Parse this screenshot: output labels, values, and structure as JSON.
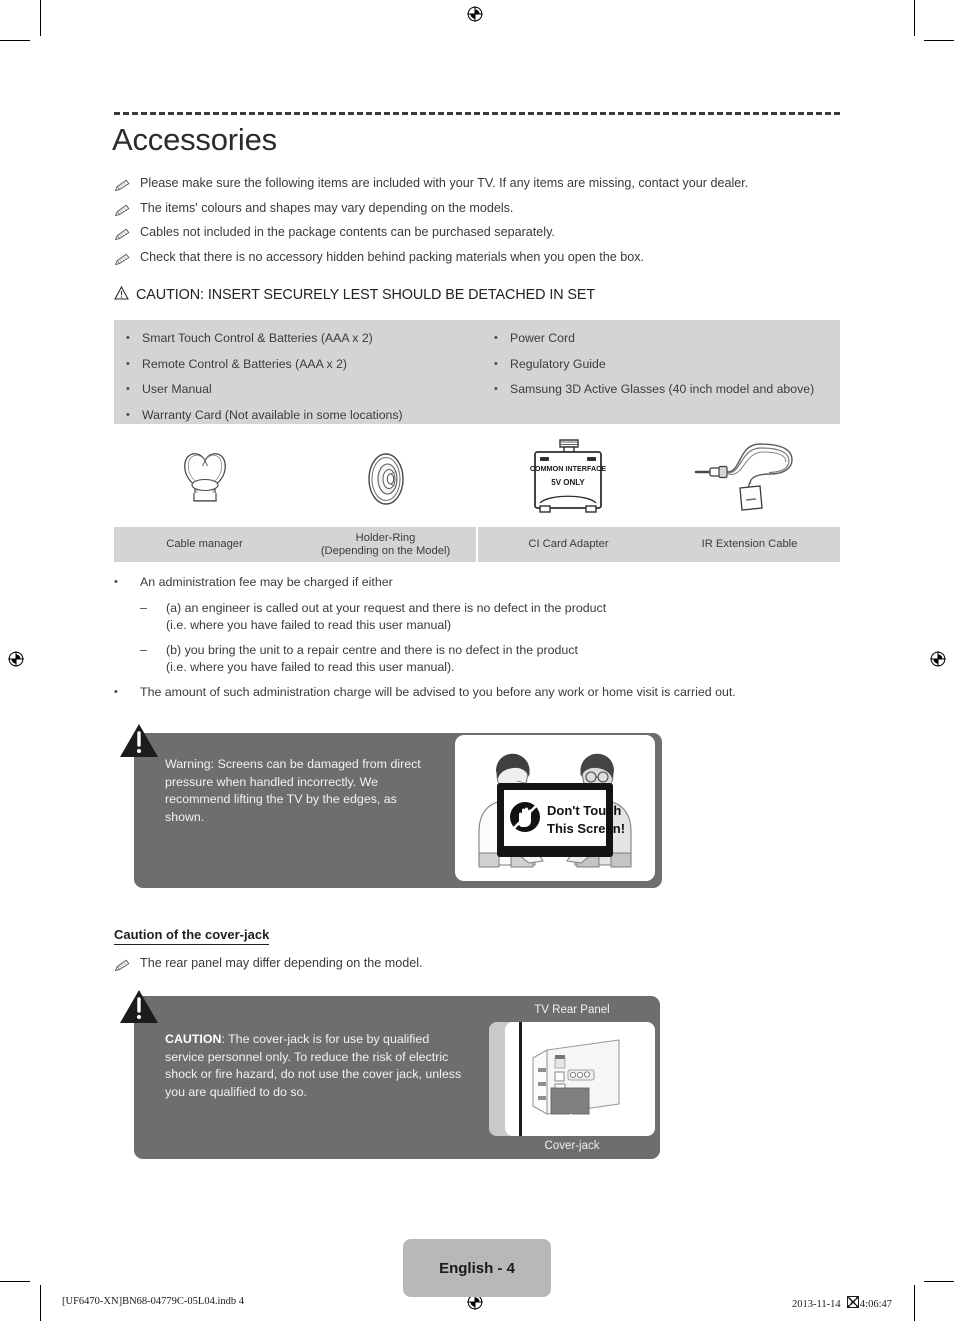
{
  "header": {
    "title": "Accessories"
  },
  "notes": [
    {
      "icon": "pencil-note-icon",
      "text": "Please make sure the following items are included with your TV. If any items are missing, contact your dealer."
    },
    {
      "icon": "pencil-note-icon",
      "text": "The items' colours and shapes may vary depending on the models."
    },
    {
      "icon": "pencil-note-icon",
      "text": "Cables not included in the package contents can be purchased separately."
    },
    {
      "icon": "pencil-note-icon",
      "text": "Check that there is no accessory hidden behind packing materials when you open the box."
    }
  ],
  "caution_headline": {
    "icon": "warning-triangle-icon",
    "text": "CAUTION: INSERT SECURELY LEST SHOULD BE DETACHED IN SET"
  },
  "accessory_box": {
    "background": "#d4d4d4",
    "bullet": "•",
    "left_column": [
      "Smart Touch Control & Batteries (AAA x 2)",
      "Remote Control & Batteries (AAA x 2)",
      "User Manual",
      "Warranty Card (Not available in some locations)"
    ],
    "right_column": [
      "Power Cord",
      "Regulatory Guide",
      "Samsung 3D Active Glasses (40 inch model and above)"
    ]
  },
  "accessory_icons": [
    {
      "icon": "cable-manager-icon",
      "label_line1": "Cable manager",
      "label_line2": ""
    },
    {
      "icon": "holder-ring-icon",
      "label_line1": "Holder-Ring",
      "label_line2": "(Depending on the Model)"
    },
    {
      "icon": "ci-card-adapter-icon",
      "label_line1": "CI Card Adapter",
      "label_line2": "",
      "badge_line1": "COMMON INTERFACE",
      "badge_line2": "5V ONLY"
    },
    {
      "icon": "ir-extension-cable-icon",
      "label_line1": "IR Extension Cable",
      "label_line2": ""
    }
  ],
  "admin_fee": [
    {
      "kind": "bullet",
      "marker": "•",
      "lines": [
        "An administration fee may be charged if either"
      ]
    },
    {
      "kind": "dash",
      "marker": "–",
      "lines": [
        "(a) an engineer is called out at your request and there is no defect in the product",
        "(i.e. where you have failed to read this user manual)"
      ]
    },
    {
      "kind": "dash",
      "marker": "–",
      "lines": [
        "(b) you bring the unit to a repair centre and there is no defect in the product",
        "(i.e. where you have failed to read this user manual)."
      ]
    },
    {
      "kind": "bullet",
      "marker": "•",
      "lines": [
        "The amount of such administration charge will be advised to you before any work or home visit is carried out."
      ]
    }
  ],
  "warning_box": {
    "background": "#6e6e6e",
    "icon": "warning-triangle-icon",
    "text": "Warning: Screens can be damaged from direct pressure when handled incorrectly. We recommend lifting the TV by the edges, as shown.",
    "illustration": {
      "name": "two-people-lifting-tv-illustration",
      "screen_line1": "Don't Touch",
      "screen_line2": "This Screen!",
      "screen_icon": "no-touch-hand-icon"
    }
  },
  "cover_jack": {
    "section_title": "Caution of the cover-jack",
    "note": {
      "icon": "pencil-note-icon",
      "text": "The rear panel may differ depending on the model."
    },
    "box": {
      "background": "#6e6e6e",
      "icon": "warning-triangle-icon",
      "strong": "CAUTION",
      "text": ": The cover-jack is for use by qualified service personnel only. To reduce the risk of electric shock or fire hazard, do not use the cover jack, unless you are qualified to do so.",
      "illustration_label": "TV Rear Panel",
      "illustration_caption": "Cover-jack",
      "illustration_name": "tv-rear-panel-illustration"
    }
  },
  "footer": {
    "page_label": "English - 4",
    "left_text": "[UF6470-XN]BN68-04779C-05L04.indb   4",
    "right_date": "2013-11-14",
    "right_time": "4:06:47"
  }
}
